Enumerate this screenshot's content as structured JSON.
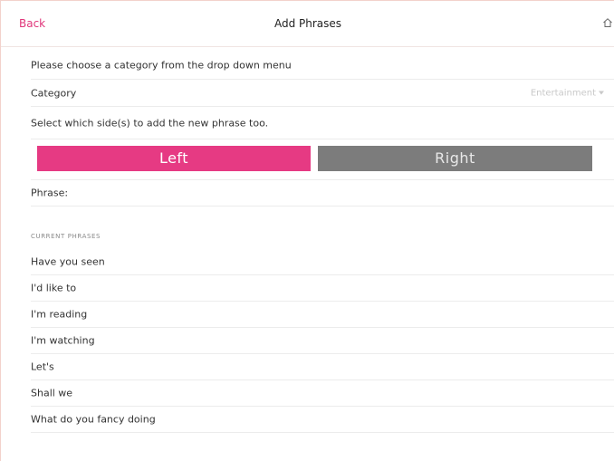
{
  "navbar": {
    "back_label": "Back",
    "title": "Add Phrases",
    "home_icon": "home-icon"
  },
  "form": {
    "instruction": "Please choose a category from the drop down menu",
    "category_label": "Category",
    "category_value": "Entertainment",
    "side_instruction": "Select which side(s) to add the new phrase too.",
    "left_label": "Left",
    "right_label": "Right",
    "phrase_label": "Phrase:"
  },
  "current_phrases": {
    "header": "CURRENT PHRASES",
    "items": [
      "Have you seen",
      "I'd like to",
      "I'm reading",
      "I'm watching",
      "Let's",
      "Shall we",
      "What do you fancy doing"
    ]
  },
  "colors": {
    "accent": "#e63a83",
    "inactive": "#7c7c7c"
  }
}
